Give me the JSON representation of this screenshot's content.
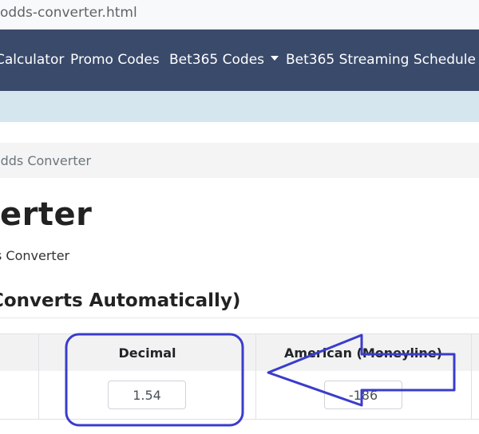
{
  "browser": {
    "url_fragment": "odds-converter.html"
  },
  "navbar": {
    "items": [
      {
        "label": "Calculator"
      },
      {
        "label": "Promo Codes"
      },
      {
        "label": "Bet365 Codes"
      },
      {
        "label": "Bet365 Streaming Schedule"
      }
    ]
  },
  "breadcrumb": {
    "current": "Odds Converter"
  },
  "page": {
    "title": "erter",
    "subtitle": "s Converter",
    "section_title": "Converts Automatically)"
  },
  "table": {
    "headers": [
      "Decimal",
      "American (Moneyline)"
    ],
    "decimal_value": "1.54",
    "american_value": "-186"
  },
  "annotation": {
    "color": "#3a3ccc"
  }
}
